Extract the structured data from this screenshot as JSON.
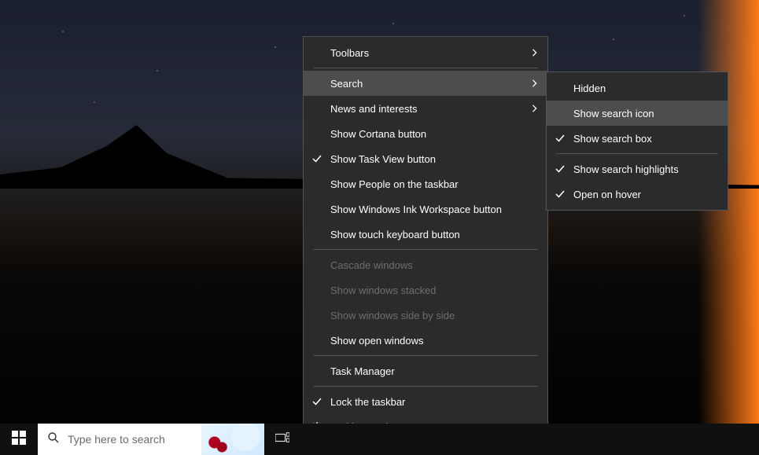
{
  "taskbar": {
    "search_placeholder": "Type here to search"
  },
  "menu1": {
    "toolbars": "Toolbars",
    "search": "Search",
    "news": "News and interests",
    "cortana": "Show Cortana button",
    "taskview": "Show Task View button",
    "people": "Show People on the taskbar",
    "ink": "Show Windows Ink Workspace button",
    "touchkb": "Show touch keyboard button",
    "cascade": "Cascade windows",
    "stacked": "Show windows stacked",
    "sidebyside": "Show windows side by side",
    "openwin": "Show open windows",
    "taskmgr": "Task Manager",
    "lock": "Lock the taskbar",
    "settings": "Taskbar settings"
  },
  "menu2": {
    "hidden": "Hidden",
    "icon": "Show search icon",
    "box": "Show search box",
    "highlights": "Show search highlights",
    "hover": "Open on hover"
  }
}
